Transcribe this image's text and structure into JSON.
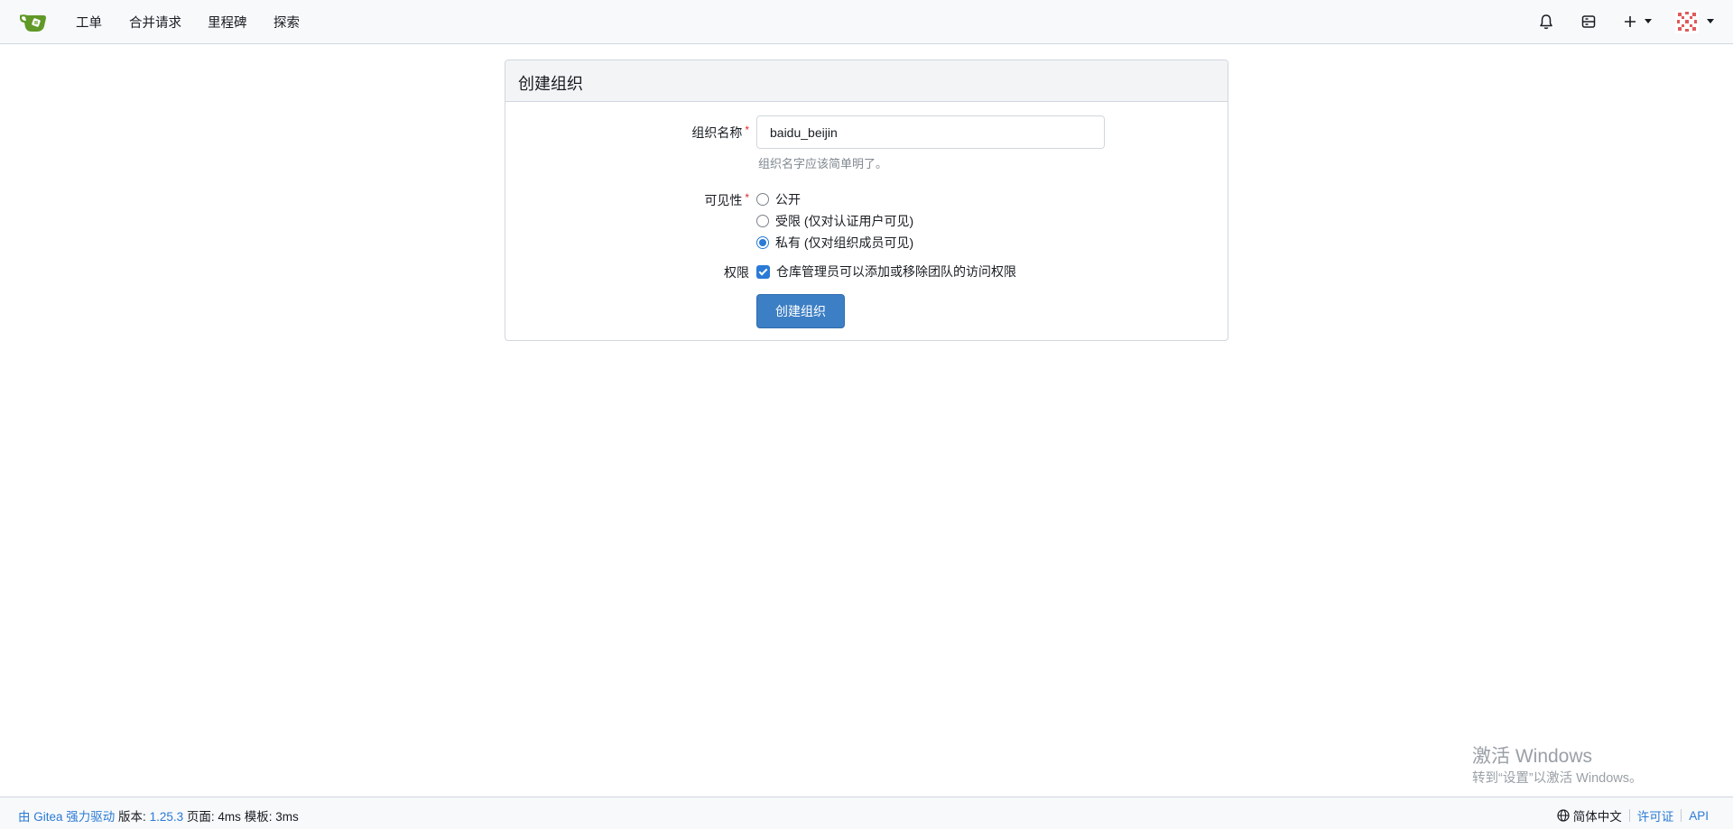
{
  "nav": {
    "items": [
      "工单",
      "合并请求",
      "里程碑",
      "探索"
    ],
    "icons": [
      "bell-icon",
      "server-icon",
      "plus-icon",
      "avatar"
    ]
  },
  "form": {
    "title": "创建组织",
    "org_name_label": "组织名称",
    "required_mark": "*",
    "org_name_value": "baidu_beijin",
    "org_name_help": "组织名字应该简单明了。",
    "visibility_label": "可见性",
    "visibility_options": [
      "公开",
      "受限 (仅对认证用户可见)",
      "私有 (仅对组织成员可见)"
    ],
    "visibility_selected": "私有 (仅对组织成员可见)",
    "permission_label": "权限",
    "permission_checkbox": "仓库管理员可以添加或移除团队的访问权限",
    "permission_checked": true,
    "submit_label": "创建组织"
  },
  "watermark": {
    "title": "激活 Windows",
    "subtitle": "转到“设置”以激活 Windows。"
  },
  "footer": {
    "powered_by": "由 Gitea 强力驱动",
    "version_label": "版本:",
    "version": "1.25.3",
    "page_label": "页面:",
    "page_time": "4ms",
    "template_label": "模板:",
    "template_time": "3ms",
    "language": "简体中文",
    "license": "许可证",
    "api": "API"
  },
  "colors": {
    "accent": "#3d7fc4",
    "link": "#2a7ad6",
    "required": "#db2828"
  }
}
